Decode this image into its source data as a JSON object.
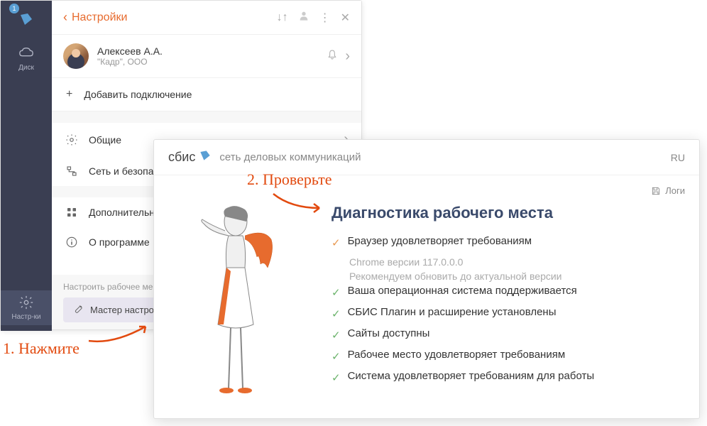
{
  "sidebar": {
    "badge": "1",
    "disk_label": "Диск",
    "settings_label": "Настр-ки"
  },
  "panel": {
    "title": "Настройки",
    "user": {
      "name": "Алексеев А.А.",
      "org": "\"Кадр\", ООО"
    },
    "add_label": "Добавить подключение",
    "menu": {
      "general": "Общие",
      "network": "Сеть и безопасность",
      "extras": "Дополнительные",
      "about": "О программе"
    },
    "footer_label": "Настроить рабочее место",
    "wizard_label": "Мастер настройки"
  },
  "diag": {
    "logo": "сбис",
    "subtitle": "сеть деловых коммуникаций",
    "lang": "RU",
    "logs": "Логи",
    "title": "Диагностика рабочего места",
    "items": [
      {
        "status": "warn",
        "text": "Браузер удовлетворяет требованиям",
        "sub1": "Chrome версии 117.0.0.0",
        "sub2": "Рекомендуем обновить до актуальной версии"
      },
      {
        "status": "ok",
        "text": "Ваша операционная система поддерживается"
      },
      {
        "status": "ok",
        "text": "СБИС Плагин и расширение установлены"
      },
      {
        "status": "ok",
        "text": "Сайты доступны"
      },
      {
        "status": "ok",
        "text": "Рабочее место удовлетворяет требованиям"
      },
      {
        "status": "ok",
        "text": "Система удовлетворяет требованиям для работы"
      }
    ]
  },
  "annotations": {
    "step1": "1. Нажмите",
    "step2": "2. Проверьте"
  }
}
